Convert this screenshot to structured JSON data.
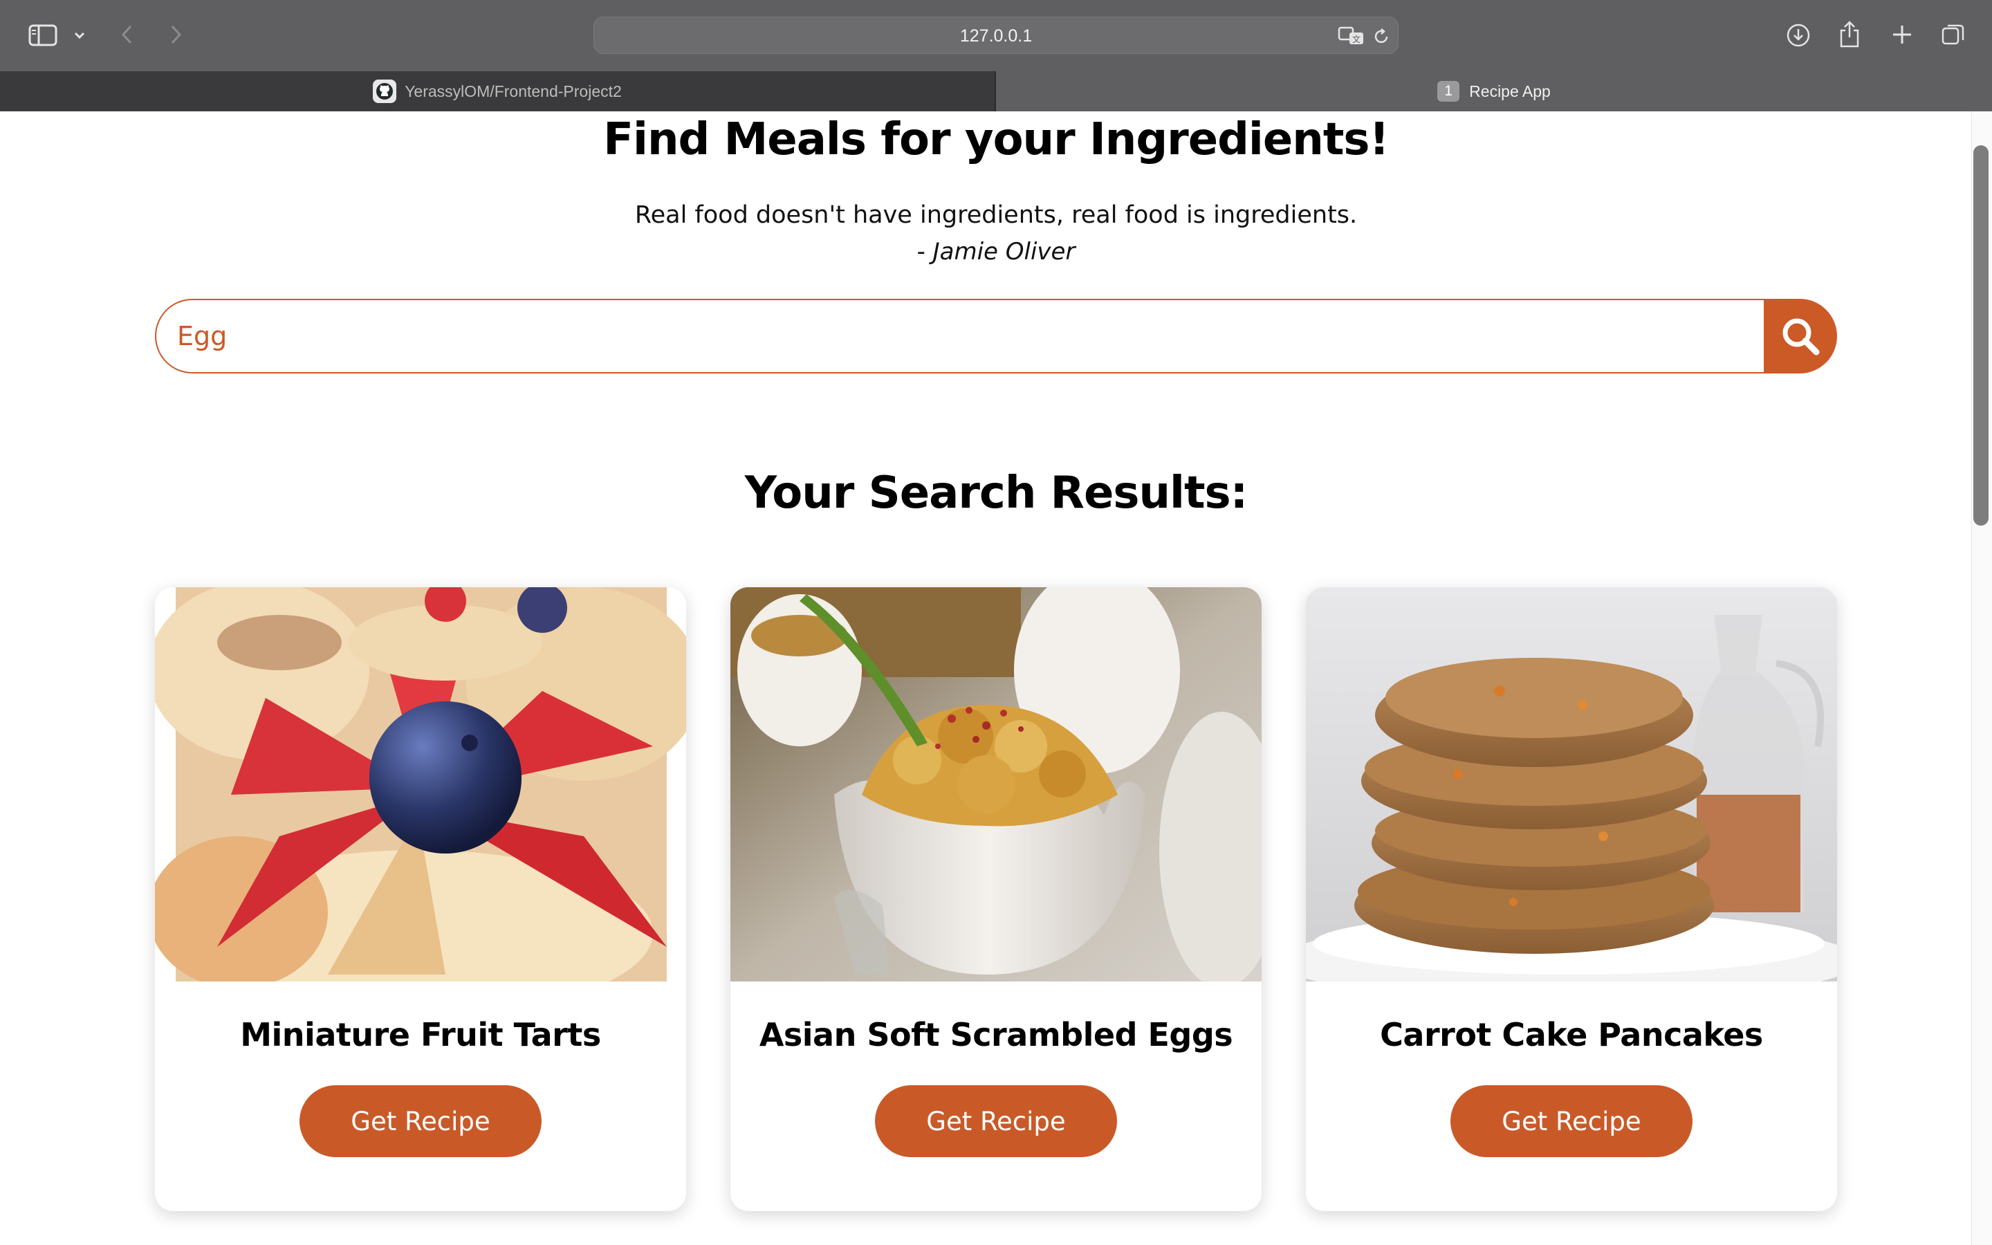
{
  "browser": {
    "url": "127.0.0.1",
    "tabs": [
      {
        "label": "YerassylOM/Frontend-Project2",
        "active": false
      },
      {
        "label": "Recipe App",
        "active": true,
        "badge": "1"
      }
    ],
    "icons": [
      "sidebar-icon",
      "chevron-down-icon",
      "back-icon",
      "forward-icon",
      "translate-icon",
      "reload-icon",
      "download-icon",
      "share-icon",
      "new-tab-icon",
      "tab-overview-icon"
    ]
  },
  "hero": {
    "title": "Find Meals for your Ingredients!",
    "quote": "Real food doesn't have ingredients, real food is ingredients.",
    "author": "- Jamie Oliver"
  },
  "search": {
    "value": "Egg",
    "button_icon": "search-icon"
  },
  "results": {
    "heading": "Your Search Results:",
    "meals": [
      {
        "name": "Miniature Fruit Tarts",
        "button": "Get Recipe",
        "image": "fruit-tarts-photo"
      },
      {
        "name": "Asian Soft Scrambled Eggs",
        "button": "Get Recipe",
        "image": "scrambled-eggs-photo"
      },
      {
        "name": "Carrot Cake Pancakes",
        "button": "Get Recipe",
        "image": "pancakes-photo"
      }
    ]
  },
  "colors": {
    "accent": "#cc5a27",
    "chrome": "#5f5f61"
  }
}
